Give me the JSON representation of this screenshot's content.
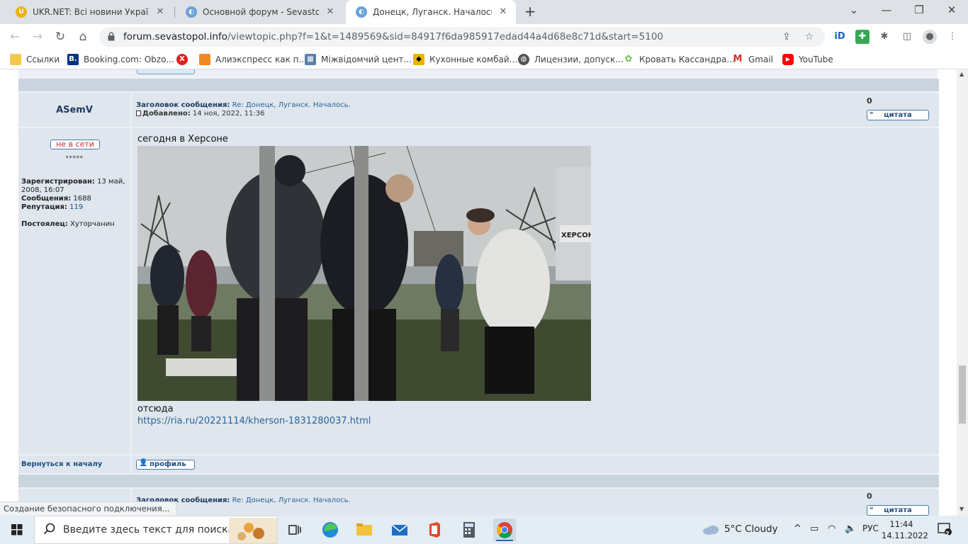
{
  "browser": {
    "tabs": [
      {
        "title": "UKR.NET: Всі новини України, ос",
        "active": false
      },
      {
        "title": "Основной форум - Sevastopol.info",
        "active": false
      },
      {
        "title": "Донецк, Луганск. Началось. - Ст",
        "active": true
      }
    ],
    "url": {
      "host": "forum.sevastopol.info",
      "path": "/viewtopic.php?f=1&t=1489569&sid=84917f6da985917edad44a4d68e8c71d&start=5100"
    },
    "bookmarks": [
      {
        "label": "Ссылки",
        "icon": "folder-icon",
        "color": "#f2c94c"
      },
      {
        "label": "Booking.com: Obzo...",
        "icon": "booking-icon",
        "color": "#003580"
      },
      {
        "label": "",
        "icon": "x-logo-icon",
        "color": "#e02020"
      },
      {
        "label": "Алиэкспресс как п...",
        "icon": "package-icon",
        "color": "#f08a24"
      },
      {
        "label": "Міжвідомчий цент...",
        "icon": "grid-icon",
        "color": "#5b7fa8"
      },
      {
        "label": "Кухонные комбай...",
        "icon": "shield-icon",
        "color": "#e8b600"
      },
      {
        "label": "Лицензии, допуск...",
        "icon": "globe-icon",
        "color": "#555555"
      },
      {
        "label": "Кровать Кассандра...",
        "icon": "flower-icon",
        "color": "#6cc04a"
      },
      {
        "label": "Gmail",
        "icon": "gmail-icon",
        "color": "#d93025"
      },
      {
        "label": "YouTube",
        "icon": "youtube-icon",
        "color": "#ff0000"
      }
    ]
  },
  "post": {
    "author": "ASemV",
    "subject_label": "Заголовок сообщения:",
    "subject": "Re: Донецк, Луганск. Началось.",
    "added_label": "Добавлено:",
    "added": "14 ноя, 2022, 11:36",
    "number": "0",
    "quote_label": "цитата",
    "status": "не в сети",
    "rank_stars": "*****",
    "registered_label": "Зарегистрирован:",
    "registered": "13 май, 2008, 16:07",
    "posts_label": "Сообщения:",
    "posts": "1688",
    "reputation_label": "Репутация:",
    "reputation": "119",
    "rank_label": "Постоялец:",
    "rank": "Хуторчанин",
    "text_top": "сегодня в Херсоне",
    "text_bottom": "отсюда",
    "link": "https://ria.ru/20221114/kherson-1831280037.html",
    "image_sign": "ХЕРСОН -",
    "back_to_top": "Вернуться к началу",
    "profile_label": "профиль"
  },
  "next_post": {
    "subject_label": "Заголовок сообщения:",
    "subject": "Re: Донецк, Луганск. Началось.",
    "number": "0",
    "quote_label": "цитата"
  },
  "status_bubble": "Создание безопасного подключения...",
  "taskbar": {
    "search_placeholder": "Введите здесь текст для поиска",
    "weather": "5°C  Cloudy",
    "lang": "РУС",
    "time": "11:44",
    "date": "14.11.2022",
    "notifications": "2"
  }
}
